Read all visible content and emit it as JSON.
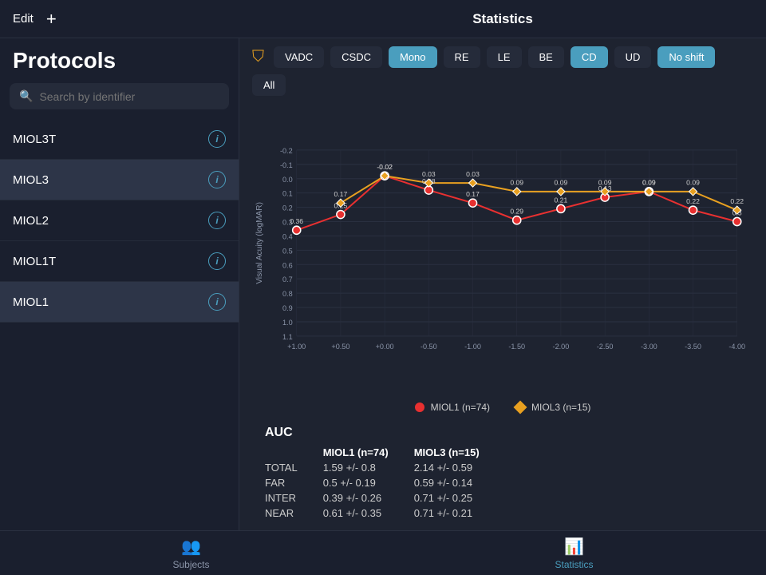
{
  "topbar": {
    "edit_label": "Edit",
    "add_label": "+",
    "title": "Statistics"
  },
  "sidebar": {
    "title": "Protocols",
    "search_placeholder": "Search by identifier",
    "items": [
      {
        "id": "MIOL3T",
        "label": "MIOL3T",
        "active": false
      },
      {
        "id": "MIOL3",
        "label": "MIOL3",
        "active": true
      },
      {
        "id": "MIOL2",
        "label": "MIOL2",
        "active": false
      },
      {
        "id": "MIOL1T",
        "label": "MIOL1T",
        "active": false
      },
      {
        "id": "MIOL1",
        "label": "MIOL1",
        "active": true
      }
    ]
  },
  "filters": {
    "buttons": [
      {
        "label": "VADC",
        "active": false
      },
      {
        "label": "CSDC",
        "active": false
      },
      {
        "label": "Mono",
        "active": true
      },
      {
        "label": "RE",
        "active": false
      },
      {
        "label": "LE",
        "active": false
      },
      {
        "label": "BE",
        "active": false
      },
      {
        "label": "CD",
        "active": true
      },
      {
        "label": "UD",
        "active": false
      },
      {
        "label": "No shift",
        "active": true
      },
      {
        "label": "All",
        "active": false
      }
    ]
  },
  "chart": {
    "y_axis_label": "Visual Acuity (logMAR)",
    "x_labels": [
      "+1.00",
      "+0.50",
      "+0.00",
      "-0.50",
      "-1.00",
      "-1.50",
      "-2.00",
      "-2.50",
      "-3.00",
      "-3.50",
      "-4.00"
    ],
    "y_labels": [
      "-0.2",
      "-0.1",
      "0.0",
      "0.1",
      "0.2",
      "0.3",
      "0.4",
      "0.5",
      "0.6",
      "0.7",
      "0.8",
      "0.9",
      "1.0",
      "1.1"
    ],
    "miol1_data": [
      {
        "x": "+1.00",
        "y": 0.36,
        "label": "0.36"
      },
      {
        "x": "+0.50",
        "y": 0.25,
        "label": "0.25"
      },
      {
        "x": "+0.00",
        "y": -0.02,
        "label": "-0.02"
      },
      {
        "x": "-0.50",
        "y": 0.08,
        "label": "0.08"
      },
      {
        "x": "-1.00",
        "y": 0.17,
        "label": "0.17"
      },
      {
        "x": "-1.50",
        "y": 0.29,
        "label": "0.29"
      },
      {
        "x": "-2.00",
        "y": 0.21,
        "label": "0.21"
      },
      {
        "x": "-2.50",
        "y": 0.13,
        "label": "0.13"
      },
      {
        "x": "-3.00",
        "y": 0.09,
        "label": "0.09"
      },
      {
        "x": "-3.50",
        "y": 0.22,
        "label": "0.22"
      },
      {
        "x": "-4.00",
        "y": 0.3,
        "label": "0.3"
      }
    ],
    "miol3_data": [
      {
        "x": "+0.50",
        "y": 0.17,
        "label": "0.17"
      },
      {
        "x": "+0.00",
        "y": -0.02,
        "label": "-0.02"
      },
      {
        "x": "-0.50",
        "y": 0.03,
        "label": "0.03"
      },
      {
        "x": "-1.00",
        "y": 0.03,
        "label": "0.03"
      },
      {
        "x": "-1.50",
        "y": 0.09,
        "label": "0.09"
      },
      {
        "x": "-2.00",
        "y": 0.09,
        "label": "0.09"
      },
      {
        "x": "-2.50",
        "y": 0.09,
        "label": "0.09"
      },
      {
        "x": "-3.00",
        "y": 0.09,
        "label": "0.09"
      },
      {
        "x": "-3.50",
        "y": 0.09,
        "label": "0.09"
      },
      {
        "x": "-4.00",
        "y": 0.22,
        "label": "0.22"
      }
    ]
  },
  "legend": {
    "miol1_label": "MIOL1 (n=74)",
    "miol3_label": "MIOL3 (n=15)",
    "miol1_color": "#e83030",
    "miol3_color": "#e8a020"
  },
  "auc": {
    "title": "AUC",
    "col1": "MIOL1 (n=74)",
    "col2": "MIOL3 (n=15)",
    "rows": [
      {
        "label": "TOTAL",
        "val1": "1.59 +/- 0.8",
        "val2": "2.14 +/- 0.59"
      },
      {
        "label": "FAR",
        "val1": "0.5 +/- 0.19",
        "val2": "0.59 +/- 0.14"
      },
      {
        "label": "INTER",
        "val1": "0.39 +/- 0.26",
        "val2": "0.71 +/- 0.25"
      },
      {
        "label": "NEAR",
        "val1": "0.61 +/- 0.35",
        "val2": "0.71 +/- 0.21"
      }
    ]
  },
  "bottom_nav": {
    "items": [
      {
        "id": "subjects",
        "label": "Subjects",
        "active": false
      },
      {
        "id": "statistics",
        "label": "Statistics",
        "active": true
      }
    ]
  }
}
